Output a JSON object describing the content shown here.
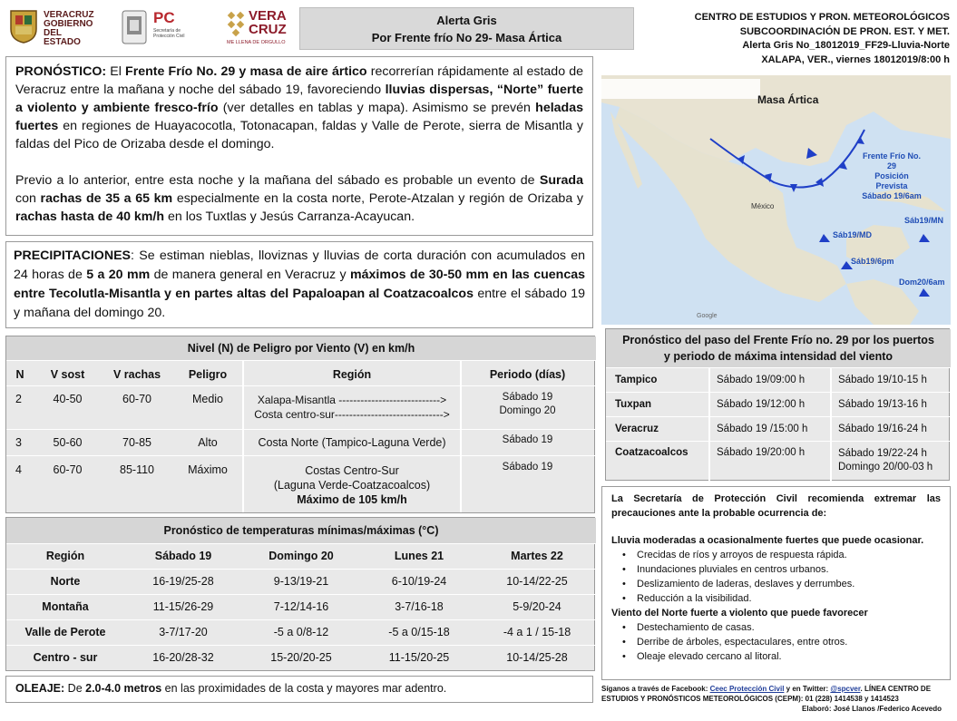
{
  "header": {
    "logos": {
      "gob_line1": "VERACRUZ",
      "gob_line2": "GOBIERNO",
      "gob_line3": "DEL ESTADO",
      "pc_label": "PC",
      "pc_sub1": "Secretaría de",
      "pc_sub2": "Protección Civil",
      "brand_line1": "VERA",
      "brand_line2": "CRUZ",
      "brand_tagline": "ME LLENA DE ORGULLO"
    },
    "alert_title": "Alerta Gris",
    "alert_subtitle": "Por  Frente frío No 29- Masa Ártica",
    "org_line1": "CENTRO DE ESTUDIOS  Y PRON. METEOROLÓGICOS",
    "org_line2": "SUBCOORDINACIÓN DE PRON.  EST. Y MET.",
    "org_line3": "Alerta Gris No_18012019_FF29-Lluvia-Norte",
    "org_line4": "XALAPA, VER., viernes 18012019/8:00 h"
  },
  "pronostico": {
    "label": "PRONÓSTICO:",
    "p1_a": " El ",
    "p1_b": "Frente Frío No. 29 y masa de aire ártico",
    "p1_c": " recorrerían rápidamente al estado de Veracruz entre la mañana y noche del sábado 19, favoreciendo ",
    "p1_d": "lluvias dispersas, “Norte” fuerte a violento y ambiente fresco-frío",
    "p1_e": " (ver detalles en tablas y mapa). Asimismo se prevén ",
    "p1_f": "heladas fuertes",
    "p1_g": " en regiones de Huayacocotla, Totonacapan, faldas y Valle de Perote, sierra de Misantla y faldas del Pico de Orizaba desde el domingo.",
    "p2_a": "Previo a lo anterior, entre esta noche y la mañana del sábado es probable un evento de ",
    "p2_b": "Surada",
    "p2_c": " con ",
    "p2_d": "rachas de 35 a 65 km",
    "p2_e": " especialmente en la costa norte, Perote-Atzalan y región de Orizaba y ",
    "p2_f": "rachas hasta de 40 km/h",
    "p2_g": " en los Tuxtlas y Jesús Carranza-Acayucan."
  },
  "precipitaciones": {
    "label": "PRECIPITACIONES",
    "a": ": Se estiman nieblas, lloviznas y lluvias de corta duración con acumulados en 24 horas de ",
    "b": "5 a 20 mm",
    "c": " de manera general en Veracruz y ",
    "d": "máximos de 30-50 mm en las cuencas entre Tecolutla-Misantla y en partes altas del Papaloapan al Coatzacoalcos",
    "e": " entre el sábado 19 y mañana del  domingo 20."
  },
  "map": {
    "masa_artica": "Masa Ártica",
    "frente_label1": "Frente Frío No. 29",
    "frente_label2": "Posición Prevista",
    "frente_label3": "Sábado 19/6am",
    "sab19md": "Sáb19/MD",
    "sab19mn": "Sáb19/MN",
    "sab19pm": "Sáb19/6pm",
    "dom20": "Dom20/6am",
    "mexico": "México",
    "google": "Google"
  },
  "wind_table": {
    "title": "Nivel  (N) de Peligro por Viento (V)  en km/h",
    "headers": [
      "N",
      "V sost",
      "V rachas",
      "Peligro",
      "Región",
      "Periodo (días)"
    ],
    "rows": [
      {
        "n": "2",
        "vsost": "40-50",
        "vrachas": "60-70",
        "peligro": "Medio",
        "region1": "Xalapa-Misantla ---------------------------->",
        "region2": "Costa centro-sur------------------------------>",
        "region3": "",
        "periodo1": "Sábado 19",
        "periodo2": "Domingo 20"
      },
      {
        "n": "3",
        "vsost": "50-60",
        "vrachas": "70-85",
        "peligro": "Alto",
        "region1": "Costa Norte (Tampico-Laguna Verde)",
        "region2": "",
        "region3": "",
        "periodo1": "Sábado 19",
        "periodo2": ""
      },
      {
        "n": "4",
        "vsost": "60-70",
        "vrachas": "85-110",
        "peligro": "Máximo",
        "region1": "Costas Centro-Sur",
        "region2": "(Laguna Verde-Coatzacoalcos)",
        "region3": "Máximo de 105  km/h",
        "periodo1": "Sábado 19",
        "periodo2": ""
      }
    ]
  },
  "temp_table": {
    "title": "Pronóstico de temperaturas mínimas/máximas (°C)",
    "headers": [
      "Región",
      "Sábado 19",
      "Domingo 20",
      "Lunes 21",
      "Martes  22"
    ],
    "rows": [
      [
        "Norte",
        "16-19/25-28",
        "9-13/19-21",
        "6-10/19-24",
        "10-14/22-25"
      ],
      [
        "Montaña",
        "11-15/26-29",
        "7-12/14-16",
        "3-7/16-18",
        "5-9/20-24"
      ],
      [
        "Valle de Perote",
        "3-7/17-20",
        "-5 a 0/8-12",
        "-5 a 0/15-18",
        "-4 a 1 / 15-18"
      ],
      [
        "Centro - sur",
        "16-20/28-32",
        "15-20/20-25",
        "11-15/20-25",
        "10-14/25-28"
      ]
    ]
  },
  "oleaje": {
    "label": "OLEAJE:",
    "a": "  De ",
    "b": "2.0-4.0  metros",
    "c": "  en las proximidades de la costa y mayores mar adentro."
  },
  "ports_table": {
    "title1": "Pronóstico del paso del Frente Frío no. 29  por los puertos",
    "title2": "y periodo de máxima intensidad del viento",
    "rows": [
      [
        "Tampico",
        "Sábado 19/09:00 h",
        "Sábado 19/10-15 h",
        ""
      ],
      [
        "Tuxpan",
        "Sábado 19/12:00 h",
        "Sábado 19/13-16 h",
        ""
      ],
      [
        "Veracruz",
        "Sábado 19 /15:00 h",
        "Sábado 19/16-24 h",
        ""
      ],
      [
        "Coatzacoalcos",
        "Sábado 19/20:00 h",
        "Sábado 19/22-24 h",
        "Domingo 20/00-03 h"
      ]
    ]
  },
  "recomendaciones": {
    "intro": "La Secretaría de Protección Civil recomienda extremar las precauciones ante la probable ocurrencia de:",
    "lluvia_title": "Lluvia moderadas a ocasionalmente fuertes que puede ocasionar.",
    "lluvia_items": [
      "Crecidas de ríos y arroyos de respuesta rápida.",
      "Inundaciones pluviales en centros urbanos.",
      "Deslizamiento de laderas, deslaves y derrumbes.",
      "Reducción a la visibilidad."
    ],
    "viento_title": "Viento del Norte fuerte a violento que puede favorecer",
    "viento_items": [
      "Destechamiento de casas.",
      "Derribe de árboles, espectaculares, entre otros.",
      "Oleaje elevado cercano al litoral."
    ]
  },
  "footer": {
    "a": "Síganos a través de Facebook: ",
    "fb": "Ceec Protección Civil",
    "b": " y en Twitter: ",
    "tw": "@spcver",
    "c": ".  LÍNEA CENTRO DE ESTUDIOS Y PRONÓSTICOS METEOROLÓGICOS (CEPM):  01 (228) 1414538 y 1414523",
    "elaboro": "Elaboró: José Llanos /Federico Acevedo"
  },
  "colors": {
    "panel_gray": "#e9e9e9",
    "title_gray": "#d6d6d6",
    "front_blue": "#1f3fc7",
    "map_label_blue": "#1f4db5"
  }
}
